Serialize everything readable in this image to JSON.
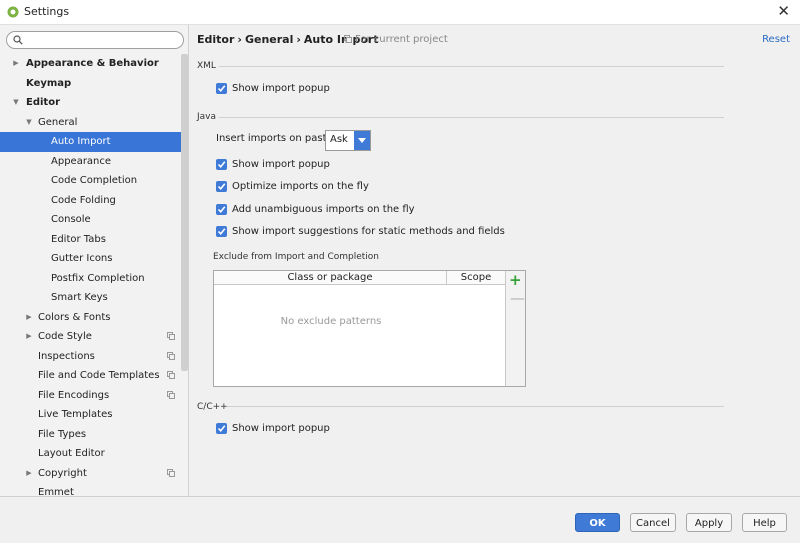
{
  "window": {
    "title": "Settings"
  },
  "search": {
    "placeholder": "",
    "value": ""
  },
  "sidebar": {
    "items": [
      {
        "label": "Appearance & Behavior",
        "level": 0,
        "bold": true,
        "arrow": "right",
        "selected": false,
        "project_icon": false
      },
      {
        "label": "Keymap",
        "level": 0,
        "bold": true,
        "arrow": "none",
        "selected": false,
        "project_icon": false
      },
      {
        "label": "Editor",
        "level": 0,
        "bold": true,
        "arrow": "down",
        "selected": false,
        "project_icon": false
      },
      {
        "label": "General",
        "level": 1,
        "bold": false,
        "arrow": "down",
        "selected": false,
        "project_icon": false
      },
      {
        "label": "Auto Import",
        "level": 2,
        "bold": false,
        "arrow": "none",
        "selected": true,
        "project_icon": false
      },
      {
        "label": "Appearance",
        "level": 2,
        "bold": false,
        "arrow": "none",
        "selected": false,
        "project_icon": false
      },
      {
        "label": "Code Completion",
        "level": 2,
        "bold": false,
        "arrow": "none",
        "selected": false,
        "project_icon": false
      },
      {
        "label": "Code Folding",
        "level": 2,
        "bold": false,
        "arrow": "none",
        "selected": false,
        "project_icon": false
      },
      {
        "label": "Console",
        "level": 2,
        "bold": false,
        "arrow": "none",
        "selected": false,
        "project_icon": false
      },
      {
        "label": "Editor Tabs",
        "level": 2,
        "bold": false,
        "arrow": "none",
        "selected": false,
        "project_icon": false
      },
      {
        "label": "Gutter Icons",
        "level": 2,
        "bold": false,
        "arrow": "none",
        "selected": false,
        "project_icon": false
      },
      {
        "label": "Postfix Completion",
        "level": 2,
        "bold": false,
        "arrow": "none",
        "selected": false,
        "project_icon": false
      },
      {
        "label": "Smart Keys",
        "level": 2,
        "bold": false,
        "arrow": "none",
        "selected": false,
        "project_icon": false
      },
      {
        "label": "Colors & Fonts",
        "level": 1,
        "bold": false,
        "arrow": "right",
        "selected": false,
        "project_icon": false
      },
      {
        "label": "Code Style",
        "level": 1,
        "bold": false,
        "arrow": "right",
        "selected": false,
        "project_icon": true
      },
      {
        "label": "Inspections",
        "level": 1,
        "bold": false,
        "arrow": "none",
        "selected": false,
        "project_icon": true
      },
      {
        "label": "File and Code Templates",
        "level": 1,
        "bold": false,
        "arrow": "none",
        "selected": false,
        "project_icon": true
      },
      {
        "label": "File Encodings",
        "level": 1,
        "bold": false,
        "arrow": "none",
        "selected": false,
        "project_icon": true
      },
      {
        "label": "Live Templates",
        "level": 1,
        "bold": false,
        "arrow": "none",
        "selected": false,
        "project_icon": false
      },
      {
        "label": "File Types",
        "level": 1,
        "bold": false,
        "arrow": "none",
        "selected": false,
        "project_icon": false
      },
      {
        "label": "Layout Editor",
        "level": 1,
        "bold": false,
        "arrow": "none",
        "selected": false,
        "project_icon": false
      },
      {
        "label": "Copyright",
        "level": 1,
        "bold": false,
        "arrow": "right",
        "selected": false,
        "project_icon": true
      },
      {
        "label": "Emmet",
        "level": 1,
        "bold": false,
        "arrow": "none",
        "selected": false,
        "project_icon": false
      }
    ]
  },
  "header": {
    "breadcrumb": [
      "Editor",
      "General",
      "Auto Import"
    ],
    "breadcrumb_sep": "›",
    "project_note": "For current project",
    "reset": "Reset"
  },
  "xml": {
    "title": "XML",
    "show_import_popup": {
      "label": "Show import popup",
      "checked": true
    }
  },
  "java": {
    "title": "Java",
    "insert_label": "Insert imports on paste:",
    "insert_value": "Ask",
    "options": [
      {
        "label": "Show import popup",
        "checked": true
      },
      {
        "label": "Optimize imports on the fly",
        "checked": true
      },
      {
        "label": "Add unambiguous imports on the fly",
        "checked": true
      },
      {
        "label": "Show import suggestions for static methods and fields",
        "checked": true
      }
    ],
    "exclude": {
      "title": "Exclude from Import and Completion",
      "col_class": "Class or package",
      "col_scope": "Scope",
      "empty": "No exclude patterns",
      "add": "+",
      "remove": "—"
    }
  },
  "cpp": {
    "title": "C/C++",
    "show_import_popup": {
      "label": "Show import popup",
      "checked": true
    }
  },
  "buttons": {
    "ok": "OK",
    "cancel": "Cancel",
    "apply": "Apply",
    "help": "Help"
  },
  "colors": {
    "accent": "#3e7ad6",
    "selected_row": "#3875d7",
    "link": "#2a6cc4",
    "add": "#37a33a"
  }
}
